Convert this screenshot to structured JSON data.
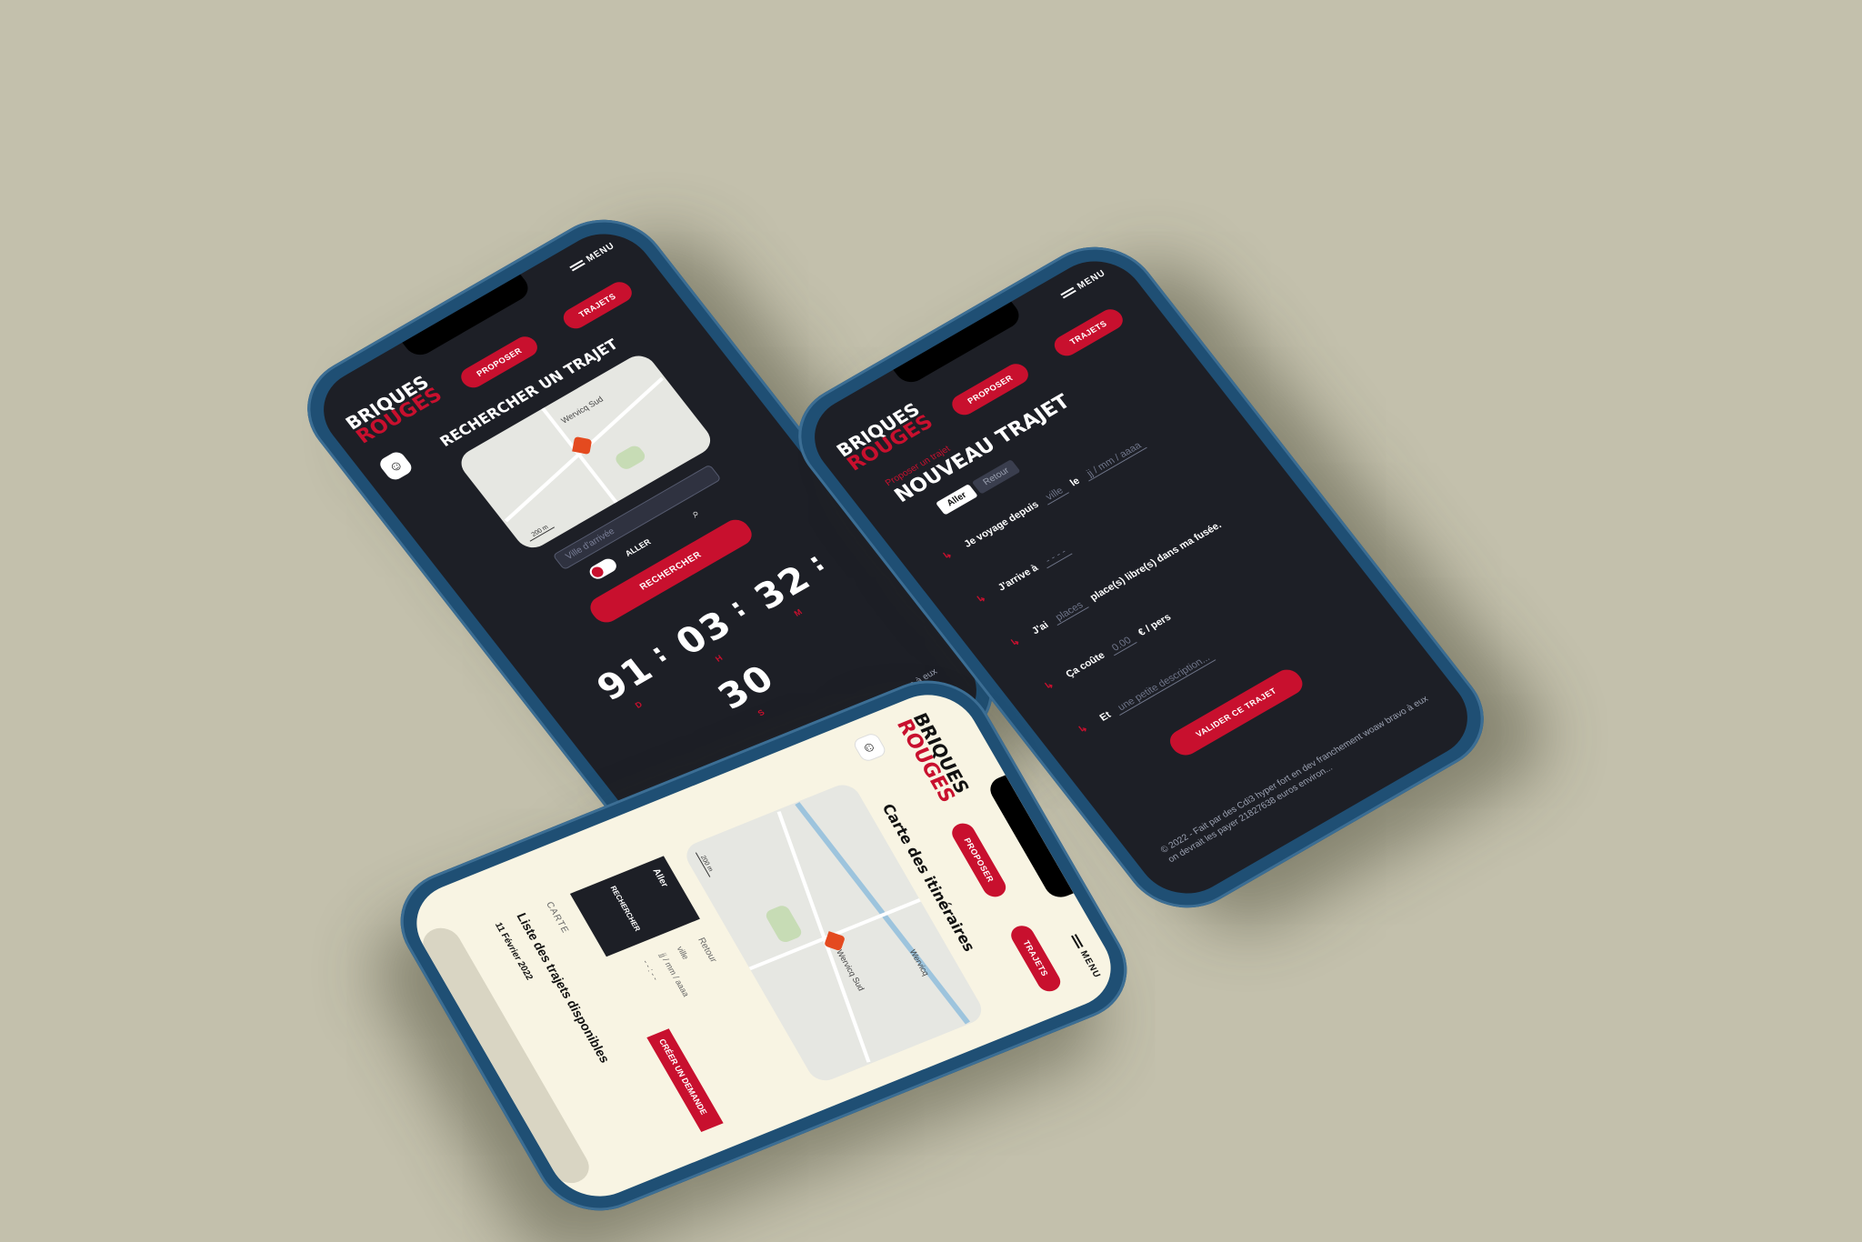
{
  "brand": {
    "line1": "BRIQUES",
    "line2": "ROUGES"
  },
  "nav": {
    "proposer": "PROPOSER",
    "trajets": "TRAJETS",
    "menu": "MENU"
  },
  "phone1": {
    "title": "RECHERCHER UN TRAJET",
    "map_label": "Wervicq Sud",
    "map_scale": "200 m",
    "arrival_placeholder": "Ville d'arrivée",
    "toggle_label": "ALLER",
    "search_button": "RECHERCHER",
    "countdown": {
      "days": "91",
      "hours": "03",
      "minutes": "32",
      "seconds": "30",
      "sep": ":",
      "unit_d": "D",
      "unit_h": "H",
      "unit_m": "M",
      "unit_s": "S"
    },
    "footer": "© 2022 - Fait par des Cdi3 hyper fort en dev franchement woaw bravo à eux on devrait les payer 21827638 euros environ..."
  },
  "phone2": {
    "subtitle": "Proposer un trajet",
    "title": "NOUVEAU TRAJET",
    "tab_aller": "Aller",
    "tab_retour": "Retour",
    "row1": "Je voyage depuis",
    "row1_hint": "ville",
    "row1b": "le",
    "row1b_hint": "jj / mm / aaaa",
    "row2": "J'arrive à",
    "row2_hint": "- - - -",
    "row3": "J'ai",
    "row3_hint": "places",
    "row3b": "place(s) libre(s) dans ma fusée.",
    "row4": "Ça coûte",
    "row4_hint": "0.00",
    "row4b": "€ / pers",
    "row5": "Et",
    "row5_hint": "une petite description...",
    "submit": "VALIDER CE TRAJET",
    "footer": "© 2022 - Fait par des Cdi3 hyper fort en dev franchement woaw bravo à eux on devrait les payer 21827638 euros environ..."
  },
  "phone3": {
    "title": "Carte des itinéraires",
    "map_label1": "Wervicq",
    "map_label2": "Wervicq Sud",
    "map_scale": "200 m",
    "tab_aller": "Aller",
    "tab_retour": "Retour",
    "field_ville": "ville",
    "field_date": "jj / mm / aaaa",
    "field_dash": "- - : - -",
    "search_button": "RECHERCHER",
    "create_button": "CRÉER UN DEMANDE",
    "carte_label": "CARTE",
    "list_title": "Liste des trajets disponibles",
    "date": "11 Février 2022"
  }
}
